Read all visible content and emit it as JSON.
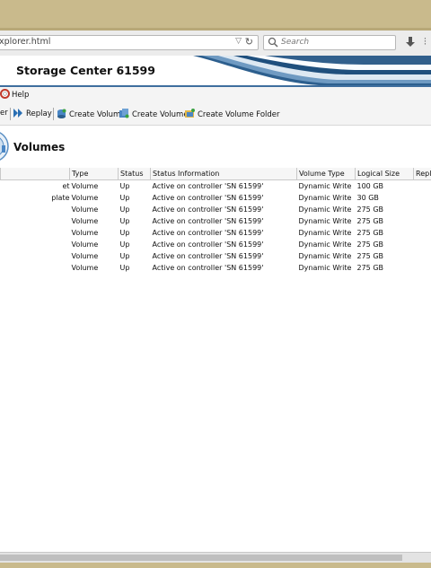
{
  "browser": {
    "url_fragment": "xplorer.html",
    "search_placeholder": "Search",
    "dropdown_glyph": "▽",
    "reload_glyph": "↻",
    "more_glyph": "⫶"
  },
  "app": {
    "title": "Storage Center 61599"
  },
  "menu": {
    "help_label": "Help"
  },
  "toolbar": {
    "cut_label": "er",
    "replay_label": "Replay",
    "create_volume_label": "Create Volume",
    "create_volumes_label": "Create Volumes",
    "create_volume_folder_label": "Create Volume Folder"
  },
  "section": {
    "title": "Volumes"
  },
  "table": {
    "columns": [
      "",
      "Type",
      "Status",
      "Status Information",
      "Volume Type",
      "Logical Size",
      "Repla"
    ],
    "rows": [
      {
        "name": "et",
        "type": "Volume",
        "status": "Up",
        "info": "Active on controller 'SN 61599'",
        "vtype": "Dynamic Write",
        "size": "100 GB"
      },
      {
        "name": "plate",
        "type": "Volume",
        "status": "Up",
        "info": "Active on controller 'SN 61599'",
        "vtype": "Dynamic Write",
        "size": "30 GB"
      },
      {
        "name": "",
        "type": "Volume",
        "status": "Up",
        "info": "Active on controller 'SN 61599'",
        "vtype": "Dynamic Write",
        "size": "275 GB"
      },
      {
        "name": "",
        "type": "Volume",
        "status": "Up",
        "info": "Active on controller 'SN 61599'",
        "vtype": "Dynamic Write",
        "size": "275 GB"
      },
      {
        "name": "",
        "type": "Volume",
        "status": "Up",
        "info": "Active on controller 'SN 61599'",
        "vtype": "Dynamic Write",
        "size": "275 GB"
      },
      {
        "name": "",
        "type": "Volume",
        "status": "Up",
        "info": "Active on controller 'SN 61599'",
        "vtype": "Dynamic Write",
        "size": "275 GB"
      },
      {
        "name": "",
        "type": "Volume",
        "status": "Up",
        "info": "Active on controller 'SN 61599'",
        "vtype": "Dynamic Write",
        "size": "275 GB"
      },
      {
        "name": "",
        "type": "Volume",
        "status": "Up",
        "info": "Active on controller 'SN 61599'",
        "vtype": "Dynamic Write",
        "size": "275 GB"
      }
    ]
  },
  "icons": {
    "help": "help-lifebuoy-icon",
    "replay": "replay-icon",
    "create_volume": "create-volume-icon",
    "create_volumes": "create-volumes-icon",
    "create_volume_folder": "create-volume-folder-icon",
    "search": "search-icon",
    "download": "download-icon"
  },
  "colors": {
    "window_frame": "#c9ba8c",
    "header_rule": "#3e6e9e",
    "toolbar_bg": "#f4f4f4"
  }
}
